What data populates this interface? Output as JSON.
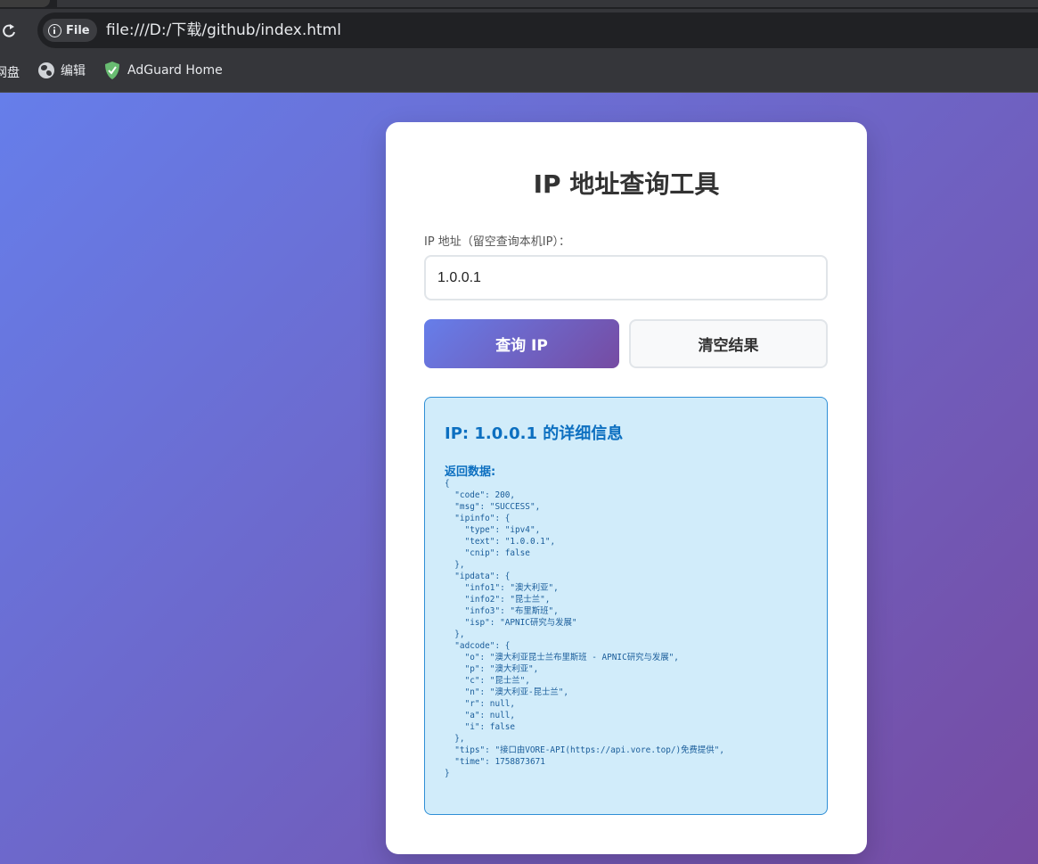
{
  "browser": {
    "site_chip": "File",
    "url": "file:///D:/下载/github/index.html",
    "bookmarks": [
      {
        "label": "网盘"
      },
      {
        "label": "编辑"
      },
      {
        "label": "AdGuard Home"
      }
    ]
  },
  "page": {
    "title": "IP 地址查询工具",
    "input_label": "IP 地址（留空查询本机IP）：",
    "input_value": "1.0.0.1",
    "query_button": "查询 IP",
    "clear_button": "清空结果",
    "result_title": "IP: 1.0.0.1 的详细信息",
    "result_subtitle": "返回数据:",
    "result_json": "{\n  \"code\": 200,\n  \"msg\": \"SUCCESS\",\n  \"ipinfo\": {\n    \"type\": \"ipv4\",\n    \"text\": \"1.0.0.1\",\n    \"cnip\": false\n  },\n  \"ipdata\": {\n    \"info1\": \"澳大利亚\",\n    \"info2\": \"昆士兰\",\n    \"info3\": \"布里斯班\",\n    \"isp\": \"APNIC研究与发展\"\n  },\n  \"adcode\": {\n    \"o\": \"澳大利亚昆士兰布里斯班 - APNIC研究与发展\",\n    \"p\": \"澳大利亚\",\n    \"c\": \"昆士兰\",\n    \"n\": \"澳大利亚-昆士兰\",\n    \"r\": null,\n    \"a\": null,\n    \"i\": false\n  },\n  \"tips\": \"接口由VORE-API(https://api.vore.top/)免费提供\",\n  \"time\": 1758873671\n}"
  },
  "colors": {
    "gradient_start": "#667eea",
    "gradient_end": "#764ba2",
    "result_bg": "#d1ecfa",
    "result_accent": "#0c6fc0"
  }
}
